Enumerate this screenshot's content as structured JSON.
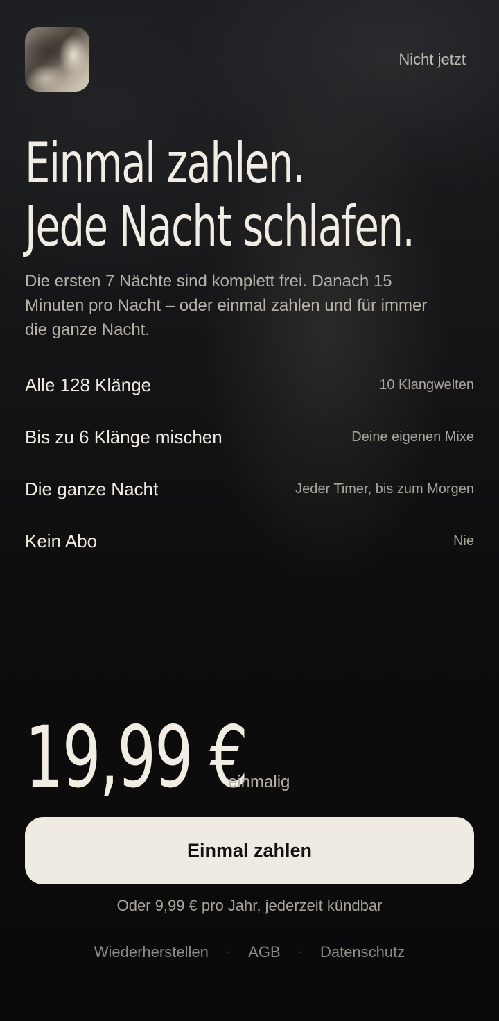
{
  "header": {
    "dismiss_label": "Nicht jetzt"
  },
  "headline": {
    "line1": "Einmal zahlen.",
    "line2": "Jede Nacht schlafen."
  },
  "subtitle": "Die ersten 7 Nächte sind komplett frei. Danach 15 Minuten pro Nacht – oder einmal zahlen und für immer die ganze Nacht.",
  "features": [
    {
      "title": "Alle 128 Klänge",
      "detail": "10 Klangwelten"
    },
    {
      "title": "Bis zu 6 Klänge mischen",
      "detail": "Deine eigenen Mixe"
    },
    {
      "title": "Die ganze Nacht",
      "detail": "Jeder Timer, bis zum Morgen"
    },
    {
      "title": "Kein Abo",
      "detail": "Nie"
    }
  ],
  "pricing": {
    "price": "19,99 €",
    "note": "einmalig",
    "cta_label": "Einmal zahlen",
    "alternative": "Oder 9,99 € pro Jahr, jederzeit kündbar"
  },
  "footer": {
    "restore": "Wiederherstellen",
    "separator": "·",
    "terms": "AGB",
    "privacy": "Datenschutz"
  },
  "colors": {
    "background": "#0c0c0d",
    "text_primary": "#f1ece3",
    "button_bg": "#efebe3",
    "button_text": "#111111"
  }
}
